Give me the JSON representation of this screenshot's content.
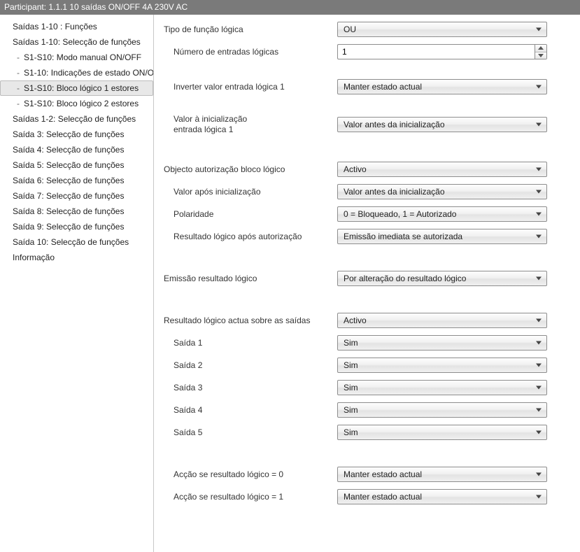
{
  "header": {
    "title": "Participant: 1.1.1  10 saídas ON/OFF 4A 230V AC"
  },
  "sidebar": {
    "items": [
      {
        "label": "Saídas 1-10 : Funções",
        "child": false,
        "selected": false
      },
      {
        "label": "Saídas 1-10: Selecção de funções",
        "child": false,
        "selected": false
      },
      {
        "label": "S1-S10: Modo manual ON/OFF",
        "child": true,
        "selected": false
      },
      {
        "label": "S1-10: Indicações de estado ON/O",
        "child": true,
        "selected": false
      },
      {
        "label": "S1-S10: Bloco lógico 1 estores",
        "child": true,
        "selected": true
      },
      {
        "label": "S1-S10: Bloco lógico 2 estores",
        "child": true,
        "selected": false
      },
      {
        "label": "Saídas 1-2: Selecção de funções",
        "child": false,
        "selected": false
      },
      {
        "label": "Saída 3: Selecção de funções",
        "child": false,
        "selected": false
      },
      {
        "label": "Saída 4: Selecção de funções",
        "child": false,
        "selected": false
      },
      {
        "label": "Saída 5: Selecção de funções",
        "child": false,
        "selected": false
      },
      {
        "label": "Saída 6: Selecção de funções",
        "child": false,
        "selected": false
      },
      {
        "label": "Saída 7: Selecção de funções",
        "child": false,
        "selected": false
      },
      {
        "label": "Saída 8: Selecção de funções",
        "child": false,
        "selected": false
      },
      {
        "label": "Saída 9: Selecção de funções",
        "child": false,
        "selected": false
      },
      {
        "label": "Saída 10: Selecção de funções",
        "child": false,
        "selected": false
      },
      {
        "label": "Informação",
        "child": false,
        "selected": false
      }
    ]
  },
  "form": {
    "tipo_funcao_label": "Tipo de função lógica",
    "tipo_funcao_value": "OU",
    "num_entradas_label": "Número de entradas lógicas",
    "num_entradas_value": "1",
    "inverter_label": "Inverter valor entrada lógica 1",
    "inverter_value": "Manter estado actual",
    "valor_init_label_l1": "Valor à inicialização",
    "valor_init_label_l2": "entrada lógica 1",
    "valor_init_value": "Valor antes da inicialização",
    "obj_aut_label": "Objecto autorização bloco lógico",
    "obj_aut_value": "Activo",
    "valor_apos_init_label": "Valor após inicialização",
    "valor_apos_init_value": "Valor antes da inicialização",
    "polaridade_label": "Polaridade",
    "polaridade_value": "0 = Bloqueado, 1 = Autorizado",
    "resultado_apos_aut_label": "Resultado lógico após autorização",
    "resultado_apos_aut_value": "Emissão imediata se autorizada",
    "emissao_label": "Emissão resultado lógico",
    "emissao_value": "Por alteração do resultado lógico",
    "resultado_saidas_label": "Resultado lógico actua sobre as saídas",
    "resultado_saidas_value": "Activo",
    "saidas": [
      {
        "label": "Saída 1",
        "value": "Sim"
      },
      {
        "label": "Saída 2",
        "value": "Sim"
      },
      {
        "label": "Saída 3",
        "value": "Sim"
      },
      {
        "label": "Saída 4",
        "value": "Sim"
      },
      {
        "label": "Saída 5",
        "value": "Sim"
      }
    ],
    "accao0_label": "Acção se resultado lógico = 0",
    "accao0_value": "Manter estado actual",
    "accao1_label": "Acção se resultado lógico = 1",
    "accao1_value": "Manter estado actual"
  }
}
